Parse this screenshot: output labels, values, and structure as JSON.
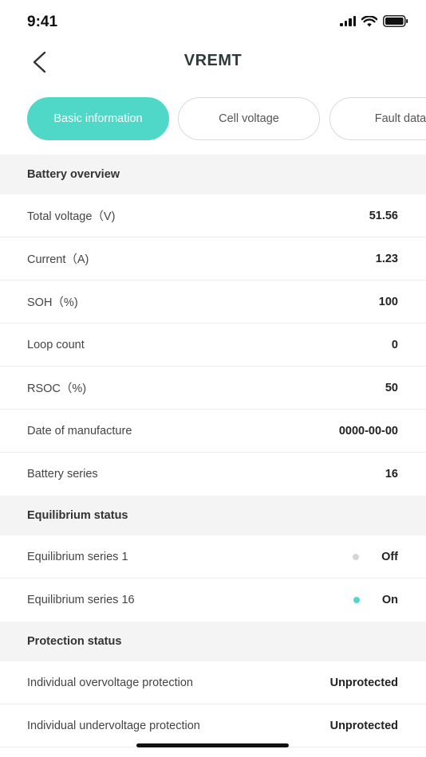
{
  "status_bar": {
    "time": "9:41"
  },
  "nav": {
    "title": "VREMT"
  },
  "tabs": [
    {
      "label": "Basic information",
      "active": true
    },
    {
      "label": "Cell voltage",
      "active": false
    },
    {
      "label": "Fault data",
      "active": false
    }
  ],
  "battery_overview": {
    "title": "Battery overview",
    "rows": [
      {
        "label": "Total voltage（V)",
        "value": "51.56"
      },
      {
        "label": "Current（A)",
        "value": "1.23"
      },
      {
        "label": "SOH（%)",
        "value": "100"
      },
      {
        "label": "Loop count",
        "value": "0"
      },
      {
        "label": "RSOC（%)",
        "value": "50"
      },
      {
        "label": "Date of manufacture",
        "value": "0000-00-00"
      },
      {
        "label": "Battery series",
        "value": "16"
      }
    ]
  },
  "equilibrium": {
    "title": "Equilibrium status",
    "rows": [
      {
        "label": "Equilibrium series 1",
        "value": "Off",
        "state": "off"
      },
      {
        "label": "Equilibrium series 16",
        "value": "On",
        "state": "on"
      }
    ]
  },
  "protection": {
    "title": "Protection status",
    "rows": [
      {
        "label": "Individual overvoltage protection",
        "value": "Unprotected"
      },
      {
        "label": "Individual undervoltage protection",
        "value": "Unprotected"
      }
    ]
  },
  "colors": {
    "accent": "#4fd8c7",
    "section_bg": "#f4f4f4",
    "off_dot": "#d6d6d6"
  },
  "icons": {
    "back": "chevron-left-icon",
    "signal": "signal-icon",
    "wifi": "wifi-icon",
    "battery": "battery-icon"
  }
}
